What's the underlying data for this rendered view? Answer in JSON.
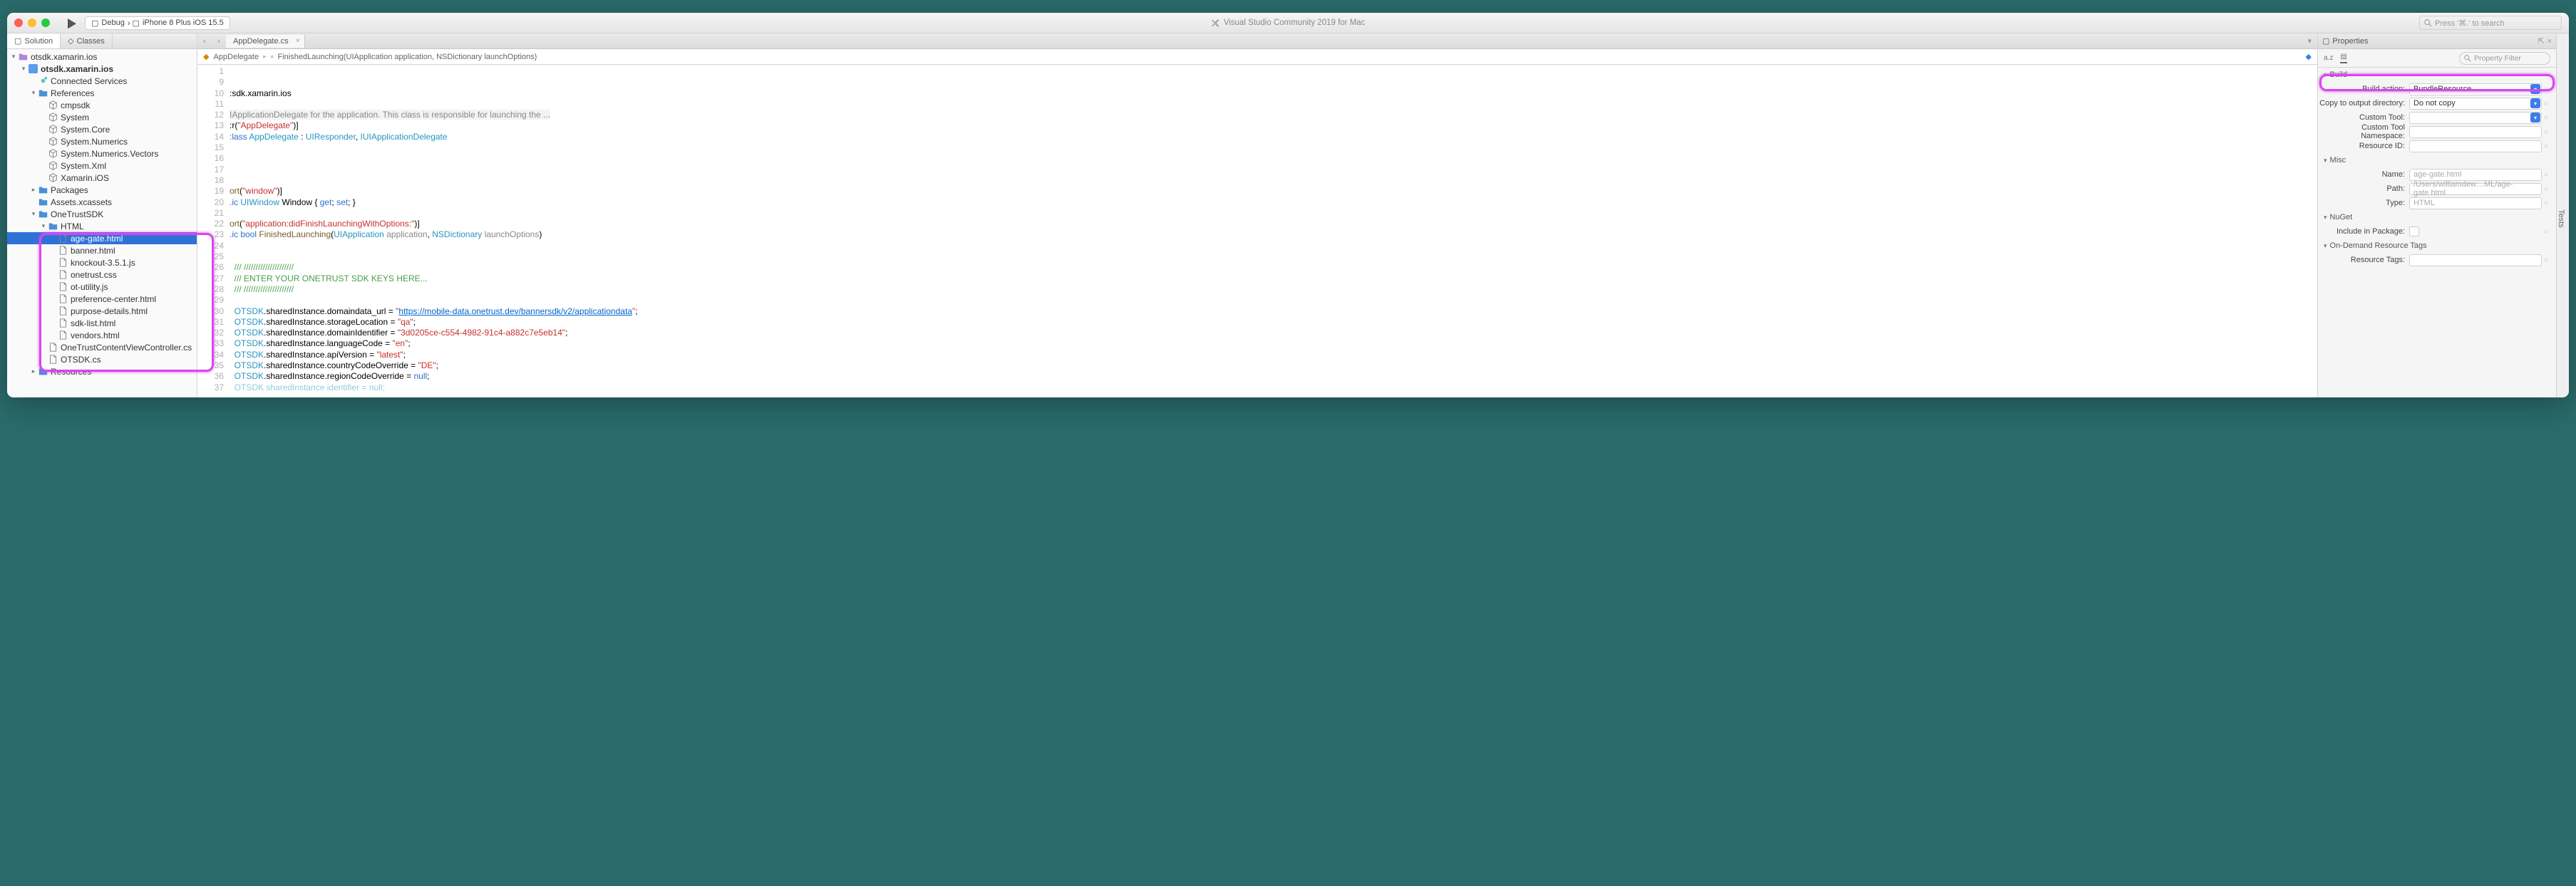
{
  "titlebar": {
    "config": "Debug",
    "device": "iPhone 8 Plus iOS 15.5",
    "app_title": "Visual Studio Community 2019 for Mac",
    "search_placeholder": "Press '⌘.' to search"
  },
  "left_panel": {
    "tab_solution": "Solution",
    "tab_classes": "Classes",
    "tree": {
      "root": "otsdk.xamarin.ios",
      "project": "otsdk.xamarin.ios",
      "connected_services": "Connected Services",
      "references": "References",
      "ref_items": [
        "cmpsdk",
        "System",
        "System.Core",
        "System.Numerics",
        "System.Numerics.Vectors",
        "System.Xml",
        "Xamarin.iOS"
      ],
      "packages": "Packages",
      "assets": "Assets.xcassets",
      "onetrust": "OneTrustSDK",
      "html_folder": "HTML",
      "html_files": [
        "age-gate.html",
        "banner.html",
        "knockout-3.5.1.js",
        "onetrust.css",
        "ot-utility.js",
        "preference-center.html",
        "purpose-details.html",
        "sdk-list.html",
        "vendors.html"
      ],
      "otcontent": "OneTrustContentViewController.cs",
      "otsdk_cs": "OTSDK.cs",
      "resources": "Resources"
    }
  },
  "editor": {
    "tab_name": "AppDelegate.cs",
    "breadcrumb_class": "AppDelegate",
    "breadcrumb_method": "FinishedLaunching(UIApplication application, NSDictionary launchOptions)",
    "lines": [
      {
        "n": 1,
        "text": ""
      },
      {
        "n": 9,
        "text": ""
      },
      {
        "n": 10,
        "html": ":sdk.xamarin.ios"
      },
      {
        "n": 11,
        "text": ""
      },
      {
        "n": 12,
        "html": "<span class='docsum'>IApplicationDelegate for the application. This class is responsible for launching the ...</span>"
      },
      {
        "n": 13,
        "html": ":r(<span class='str'>\"AppDelegate\"</span>)]"
      },
      {
        "n": 14,
        "html": "<span class='kw'>:lass</span> <span class='type'>AppDelegate</span> : <span class='type'>UIResponder</span>, <span class='type'>IUIApplicationDelegate</span>"
      },
      {
        "n": 15,
        "text": ""
      },
      {
        "n": 16,
        "text": ""
      },
      {
        "n": 17,
        "text": ""
      },
      {
        "n": 18,
        "text": ""
      },
      {
        "n": 19,
        "html": "<span class='method'>ort</span>(<span class='str'>\"window\"</span>)]"
      },
      {
        "n": 20,
        "html": "<span class='kw'>.ic</span> <span class='type'>UIWindow</span> Window { <span class='kw'>get</span>; <span class='kw'>set</span>; }"
      },
      {
        "n": 21,
        "text": ""
      },
      {
        "n": 22,
        "html": "<span class='method'>ort</span>(<span class='str'>\"application:didFinishLaunchingWithOptions:\"</span>)]"
      },
      {
        "n": 23,
        "html": "<span class='kw'>.ic bool</span> <span class='method'>FinishedLaunching</span>(<span class='type'>UIApplication</span> <span style='color:#888'>application</span>, <span class='type'>NSDictionary</span> <span style='color:#888'>launchOptions</span>)"
      },
      {
        "n": 24,
        "text": ""
      },
      {
        "n": 25,
        "text": ""
      },
      {
        "n": 26,
        "html": "  <span class='comment'>/// /////////////////////</span>"
      },
      {
        "n": 27,
        "html": "  <span class='comment'>/// ENTER YOUR ONETRUST SDK KEYS HERE...</span>"
      },
      {
        "n": 28,
        "html": "  <span class='comment'>/// /////////////////////</span>"
      },
      {
        "n": 29,
        "text": ""
      },
      {
        "n": 30,
        "html": "  <span class='type'>OTSDK</span>.sharedInstance.domaindata_url = <span class='str'>\"</span><span class='url'>https://mobile-data.onetrust.dev/bannersdk/v2/applicationdata</span><span class='str'>\"</span>;"
      },
      {
        "n": 31,
        "html": "  <span class='type'>OTSDK</span>.sharedInstance.storageLocation = <span class='str'>\"qa\"</span>;"
      },
      {
        "n": 32,
        "html": "  <span class='type'>OTSDK</span>.sharedInstance.domainIdentifier = <span class='str'>\"3d0205ce-c554-4982-91c4-a882c7e5eb14\"</span>;"
      },
      {
        "n": 33,
        "html": "  <span class='type'>OTSDK</span>.sharedInstance.languageCode = <span class='str'>\"en\"</span>;"
      },
      {
        "n": 34,
        "html": "  <span class='type'>OTSDK</span>.sharedInstance.apiVersion = <span class='str'>\"latest\"</span>;"
      },
      {
        "n": 35,
        "html": "  <span class='type'>OTSDK</span>.sharedInstance.countryCodeOverride = <span class='str'>\"DE\"</span>;"
      },
      {
        "n": 36,
        "html": "  <span class='type'>OTSDK</span>.sharedInstance.regionCodeOverride = <span class='kw'>null</span>;"
      },
      {
        "n": 37,
        "html": "  <span class='type' style='opacity:.5'>OTSDK sharedInstance identifier = null;</span>"
      }
    ]
  },
  "properties": {
    "title": "Properties",
    "filter_placeholder": "Property Filter",
    "build": {
      "heading": "Build",
      "action_label": "Build action:",
      "action_value": "BundleResource",
      "copy_label": "Copy to output directory:",
      "copy_value": "Do not copy",
      "tool_label": "Custom Tool:",
      "ns_label": "Custom Tool Namespace:",
      "resid_label": "Resource ID:"
    },
    "misc": {
      "heading": "Misc",
      "name_label": "Name:",
      "name_value": "age-gate.html",
      "path_label": "Path:",
      "path_value": "/Users/williamdew…ML/age-gate.html",
      "type_label": "Type:",
      "type_value": "HTML"
    },
    "nuget": {
      "heading": "NuGet",
      "include_label": "Include in Package:"
    },
    "tags": {
      "heading": "On-Demand Resource Tags",
      "label": "Resource Tags:"
    }
  },
  "tests_tab": "Tests"
}
